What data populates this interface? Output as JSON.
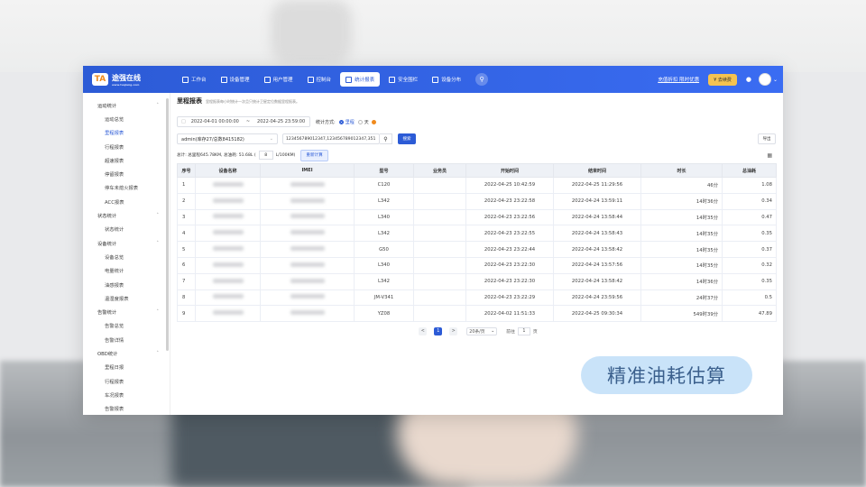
{
  "brand": {
    "logo_mark": "TA",
    "name": "途强在线",
    "sub": "www.tuqiang.com"
  },
  "nav": [
    {
      "label": "工作台"
    },
    {
      "label": "设备管理"
    },
    {
      "label": "用户管理"
    },
    {
      "label": "控制台"
    },
    {
      "label": "统计报表",
      "active": true
    },
    {
      "label": "安全围栏"
    },
    {
      "label": "设备分布"
    }
  ],
  "top_right": {
    "link": "充值折扣 限时优惠",
    "pill": "¥ 去续费"
  },
  "sidebar": [
    {
      "group": "运动统计",
      "items": [
        "运动总览",
        "里程报表",
        "行程报表",
        "超速报表",
        "停留报表",
        "停车未熄火报表",
        "ACC报表"
      ]
    },
    {
      "group": "状态统计",
      "items": [
        "状态统计"
      ]
    },
    {
      "group": "设备统计",
      "items": [
        "设备总览",
        "电量统计",
        "油感报表",
        "温湿度报表"
      ]
    },
    {
      "group": "告警统计",
      "items": [
        "告警总览",
        "告警详情"
      ]
    },
    {
      "group": "OBD统计",
      "items": [
        "里程日报",
        "行程报表",
        "车况报表",
        "告警报表"
      ]
    }
  ],
  "page": {
    "title": "里程报表",
    "desc": "里程报表每小时统计一次且只统计卫星定位数据里程报表。",
    "date_start": "2022-04-01 00:00:00",
    "date_sep": "~",
    "date_end": "2022-04-25 23:59:00",
    "mode_label": "统计方式:",
    "mode_on": "里程",
    "mode_off": "天",
    "account": "admin(库存27/总数8415182)",
    "imei_value": "123456789012347,123456789012347,351",
    "query": "搜索",
    "export": "导出",
    "summary_prefix": "总计: 总里程645.78KM, 总油耗: 51.68L (",
    "fuel_value": "8",
    "summary_suffix": "L/100KM)",
    "recalc": "重新计算"
  },
  "table": {
    "headers": [
      "序号",
      "设备名称",
      "IMEI",
      "型号",
      "业务员",
      "开始时间",
      "结束时间",
      "时长",
      "总油耗"
    ],
    "rows": [
      [
        "1",
        "",
        "",
        "C120",
        "",
        "2022-04-25 10:42:59",
        "2022-04-25 11:29:56",
        "46分",
        "1.08"
      ],
      [
        "2",
        "",
        "",
        "L342",
        "",
        "2022-04-23 23:22:58",
        "2022-04-24 13:59:11",
        "14时36分",
        "0.34"
      ],
      [
        "3",
        "",
        "",
        "L340",
        "",
        "2022-04-23 23:22:56",
        "2022-04-24 13:58:44",
        "14时35分",
        "0.47"
      ],
      [
        "4",
        "",
        "",
        "L342",
        "",
        "2022-04-23 23:22:55",
        "2022-04-24 13:58:43",
        "14时35分",
        "0.35"
      ],
      [
        "5",
        "",
        "",
        "G50",
        "",
        "2022-04-23 23:22:44",
        "2022-04-24 13:58:42",
        "14时35分",
        "0.37"
      ],
      [
        "6",
        "",
        "",
        "L340",
        "",
        "2022-04-23 23:22:30",
        "2022-04-24 13:57:56",
        "14时35分",
        "0.32"
      ],
      [
        "7",
        "",
        "",
        "L342",
        "",
        "2022-04-23 23:22:30",
        "2022-04-24 13:58:42",
        "14时36分",
        "0.35"
      ],
      [
        "8",
        "",
        "",
        "JM-V341",
        "",
        "2022-04-23 23:22:29",
        "2022-04-24 23:59:56",
        "24时37分",
        "0.5"
      ],
      [
        "9",
        "",
        "",
        "YZ08",
        "",
        "2022-04-02 11:51:33",
        "2022-04-25 09:30:34",
        "549时39分",
        "47.89"
      ]
    ]
  },
  "pager": {
    "prev": "<",
    "current": "1",
    "next": ">",
    "size": "20条/页",
    "goto_label": "前往",
    "goto_value": "1",
    "goto_suffix": "页"
  },
  "caption": "精准油耗估算"
}
